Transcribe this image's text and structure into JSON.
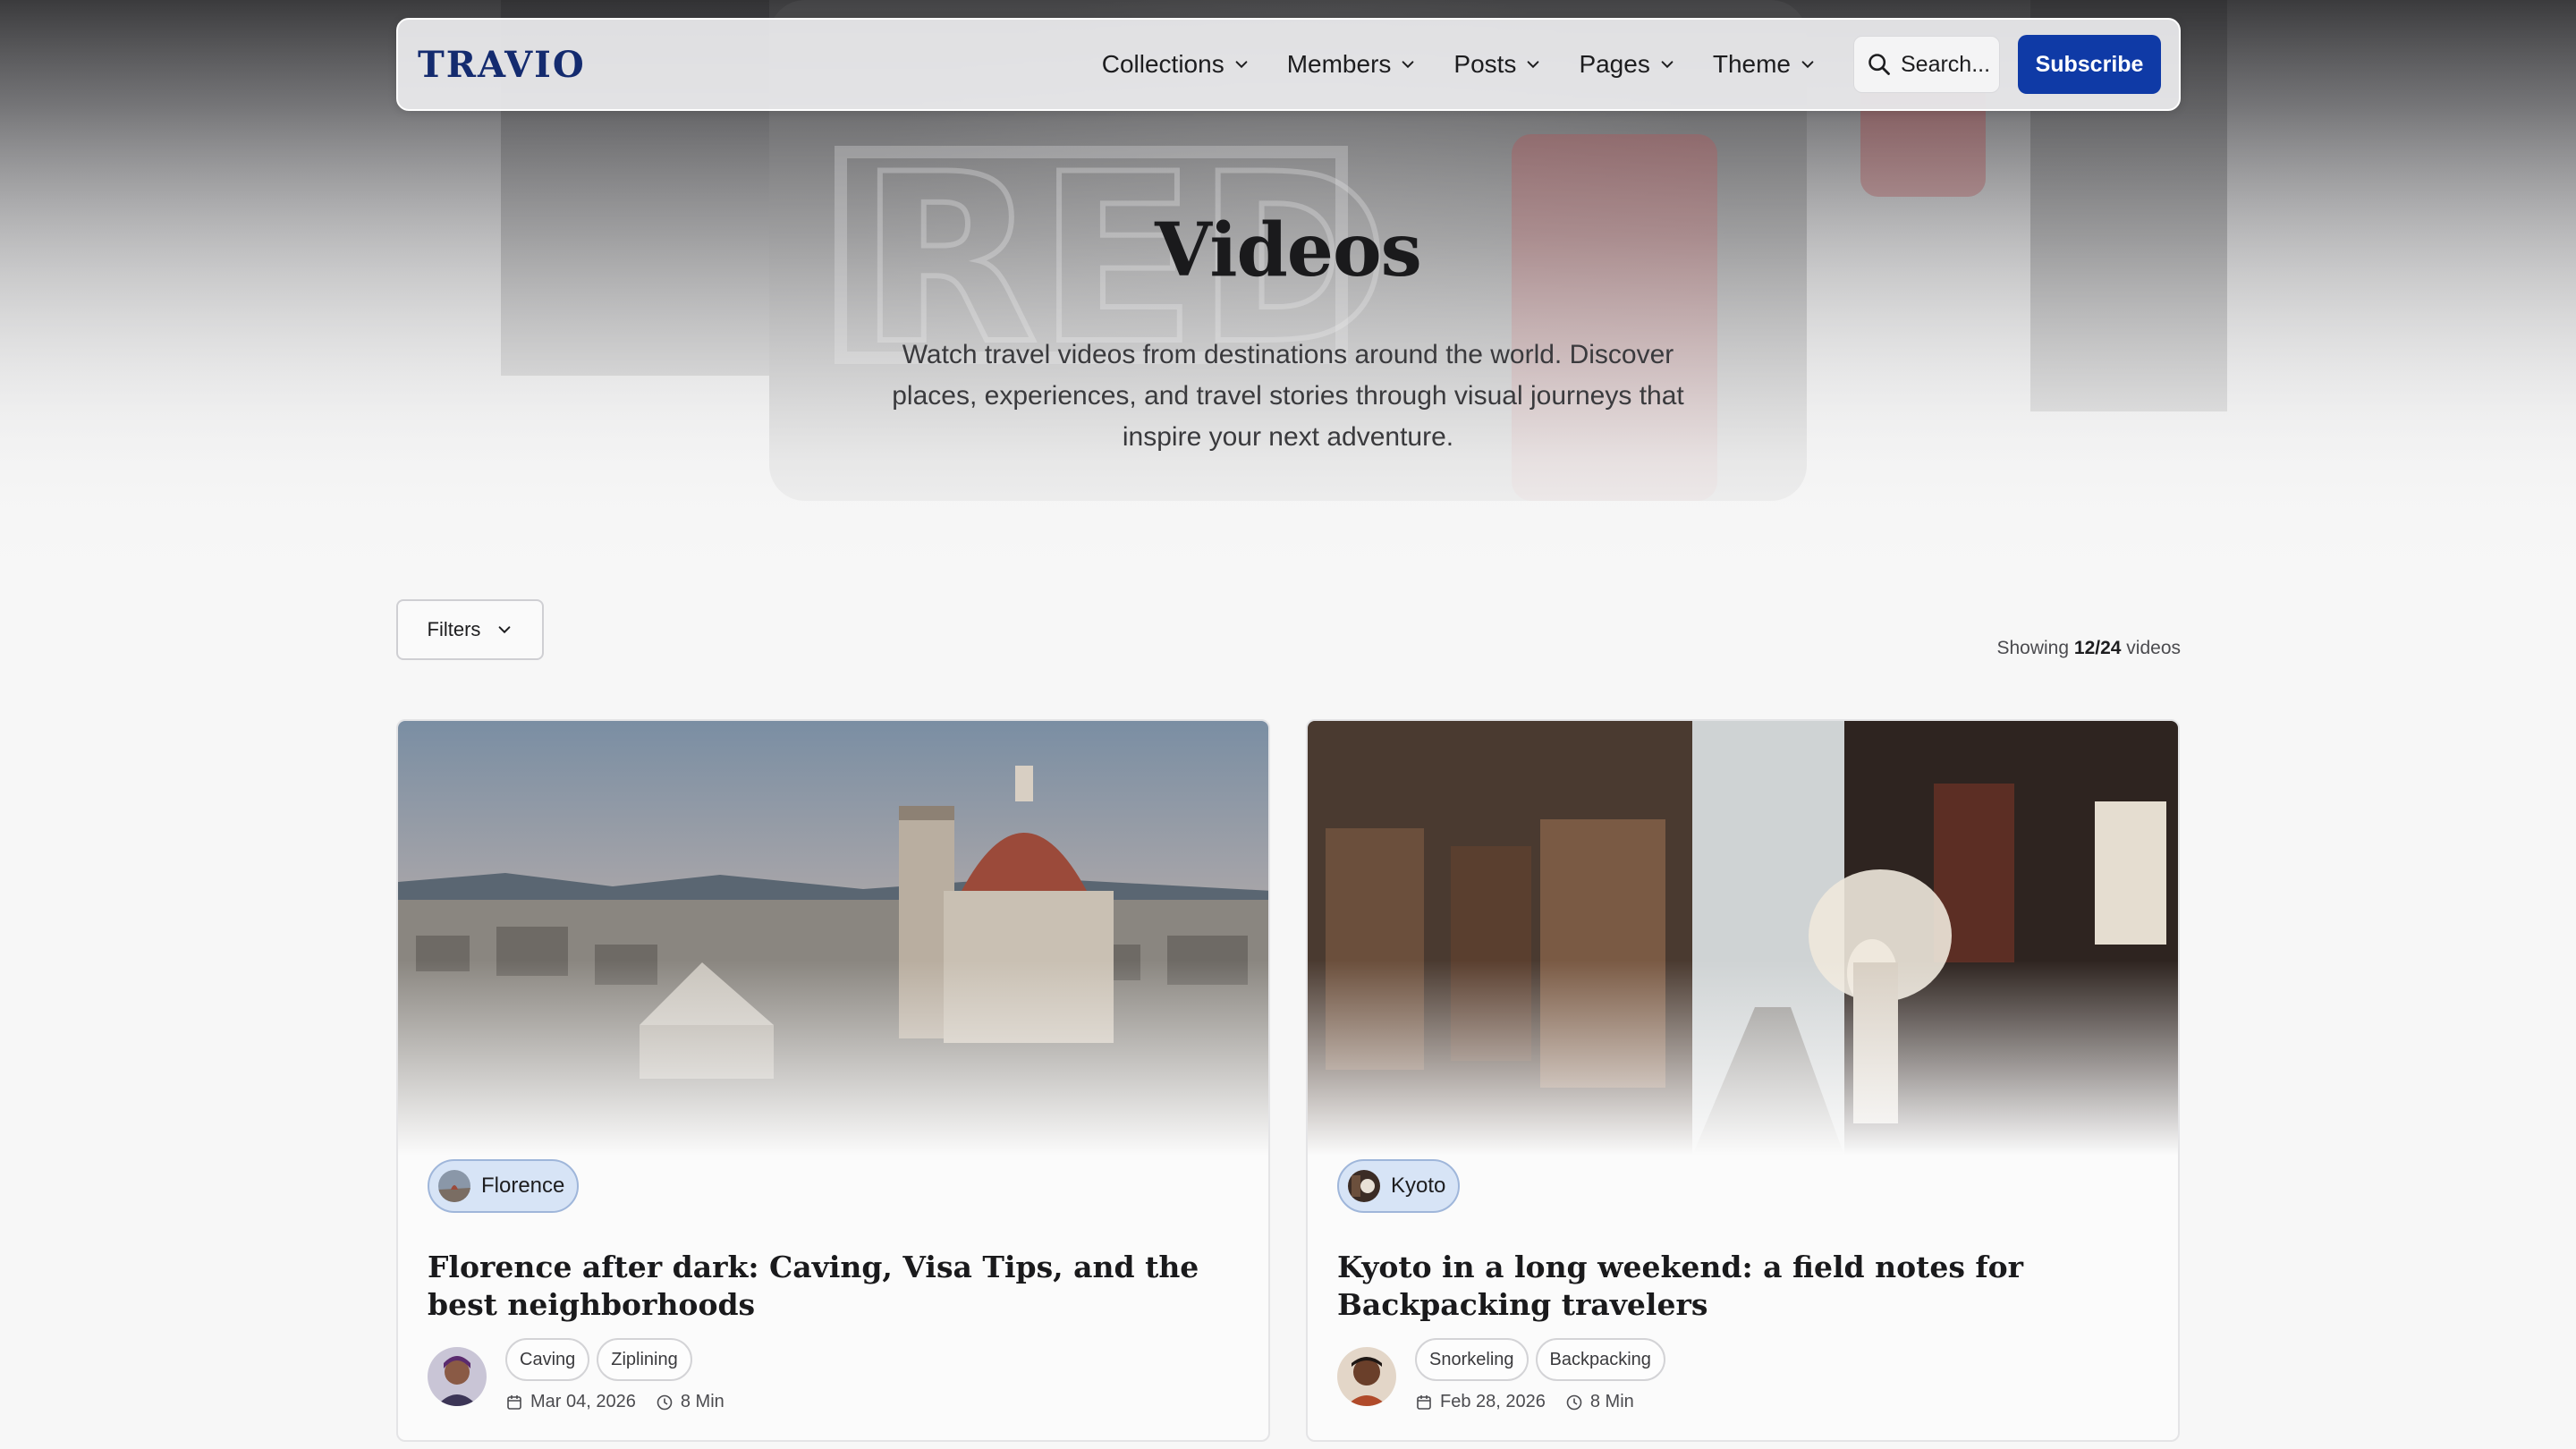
{
  "nav": {
    "logo": "TRAVIO",
    "menu": [
      {
        "label": "Collections"
      },
      {
        "label": "Members"
      },
      {
        "label": "Posts"
      },
      {
        "label": "Pages"
      },
      {
        "label": "Theme"
      }
    ],
    "search_placeholder": "Search...",
    "subscribe_label": "Subscribe",
    "accent_color": "#0f3aa6",
    "logo_color": "#142b6f"
  },
  "hero": {
    "title": "Videos",
    "description": "Watch travel videos from destinations around the world. Discover places, experiences, and travel stories through visual journeys that inspire your next adventure."
  },
  "toolbar": {
    "filters_label": "Filters",
    "showing_prefix": "Showing",
    "showing_count": "12/24",
    "showing_suffix": "videos"
  },
  "cards": [
    {
      "location": "Florence",
      "title": "Florence after dark: Caving, Visa Tips, and the best neighborhoods",
      "tags": [
        "Caving",
        "Ziplining"
      ],
      "date": "Mar 04, 2026",
      "duration": "8 Min"
    },
    {
      "location": "Kyoto",
      "title": "Kyoto in a long weekend: a field notes for Backpacking travelers",
      "tags": [
        "Snorkeling",
        "Backpacking"
      ],
      "date": "Feb 28, 2026",
      "duration": "8 Min"
    }
  ]
}
